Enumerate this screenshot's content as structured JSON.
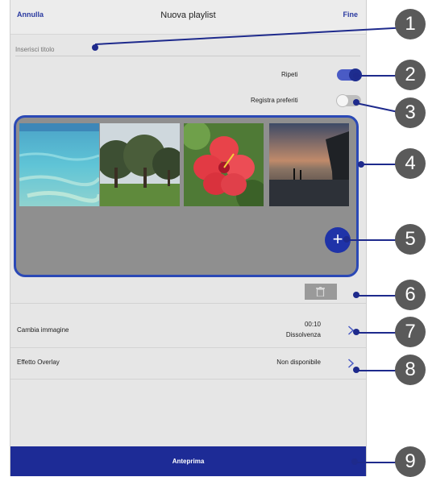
{
  "header": {
    "cancel_label": "Annulla",
    "title": "Nuova playlist",
    "done_label": "Fine"
  },
  "title_field": {
    "placeholder": "Inserisci titolo",
    "value": ""
  },
  "options": {
    "repeat": {
      "label": "Ripeti",
      "state": "on"
    },
    "favorites": {
      "label": "Registra preferiti",
      "state": "off"
    }
  },
  "images_panel": {
    "thumbnails": [
      {
        "description": "sea-water"
      },
      {
        "description": "park-trees"
      },
      {
        "description": "red-hibiscus-flower"
      },
      {
        "description": "sunset-beach"
      }
    ],
    "add_icon": "plus-icon"
  },
  "delete_icon": "trash-icon",
  "settings": {
    "change_image": {
      "label": "Cambia immagine",
      "time": "00:10",
      "effect": "Dissolvenza"
    },
    "overlay_effect": {
      "label": "Effetto Overlay",
      "value": "Non disponibile"
    }
  },
  "preview_label": "Anteprima",
  "callouts": [
    "1",
    "2",
    "3",
    "4",
    "5",
    "6",
    "7",
    "8",
    "9"
  ],
  "colors": {
    "accent": "#1d2b96",
    "callout": "#5a5a5a",
    "panel_border": "#2b49b6"
  }
}
